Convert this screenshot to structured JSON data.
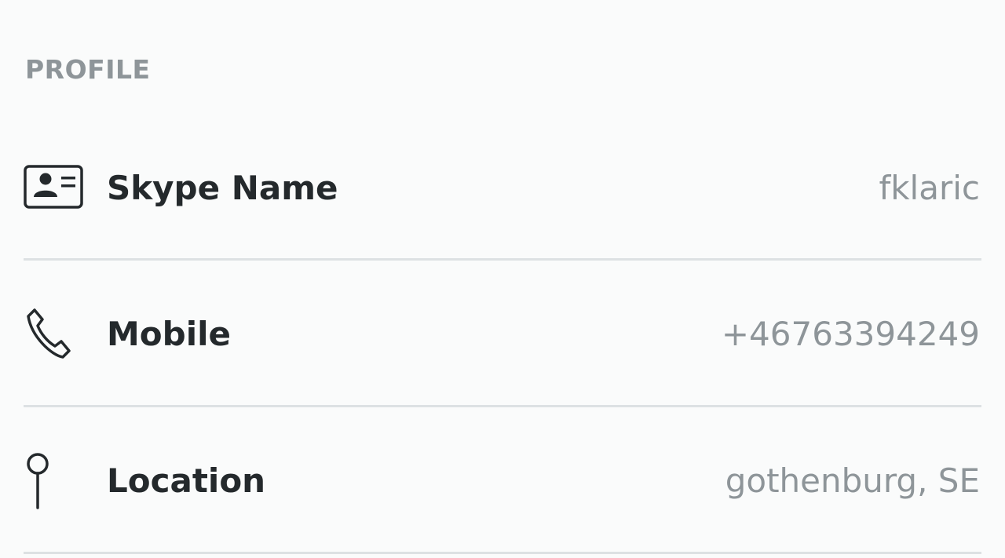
{
  "profile": {
    "section_title": "PROFILE",
    "rows": [
      {
        "icon": "contact-card-icon",
        "label": "Skype Name",
        "value": "fklaric"
      },
      {
        "icon": "phone-icon",
        "label": "Mobile",
        "value": "+46763394249"
      },
      {
        "icon": "location-pin-icon",
        "label": "Location",
        "value": "gothenburg, SE"
      }
    ]
  },
  "colors": {
    "background": "#fafbfb",
    "header_text": "#8e9599",
    "label_text": "#24292c",
    "value_text": "#8e9599",
    "divider": "#dde1e3"
  }
}
